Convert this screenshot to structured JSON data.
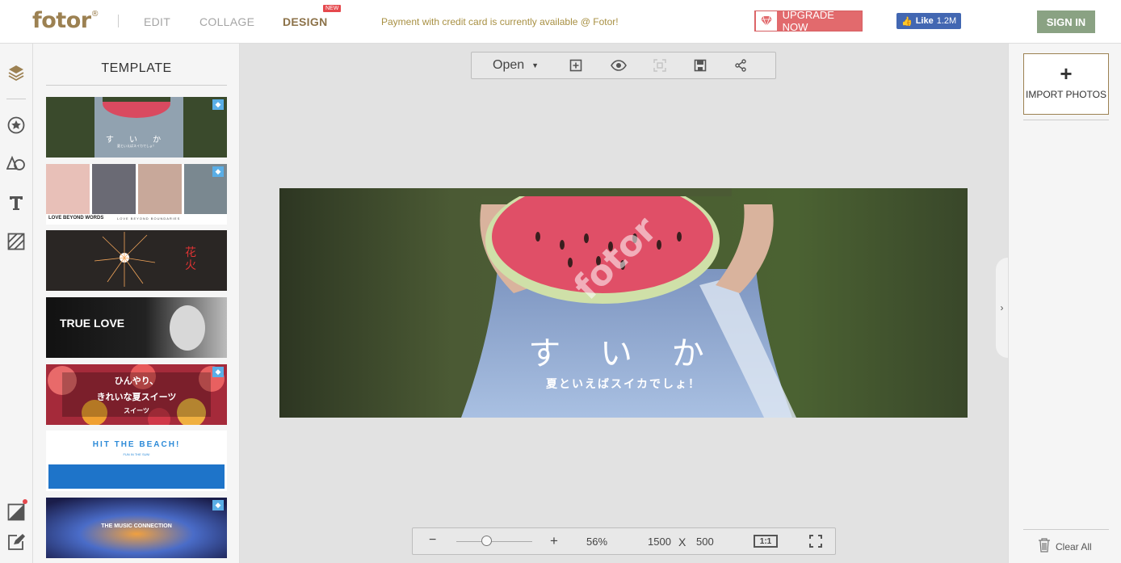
{
  "header": {
    "logo": "fotor",
    "logo_mark": "®",
    "nav": [
      "EDIT",
      "COLLAGE",
      "DESIGN"
    ],
    "new_badge": "NEW",
    "promo": "Payment with credit card is currently available @ Fotor!",
    "upgrade_label": "UPGRADE NOW",
    "fb_like": "Like",
    "fb_count": "1.2M",
    "signin": "SIGN IN"
  },
  "sidebar": {
    "icons": [
      "layers-icon",
      "sticker-icon",
      "shapes-icon",
      "text-icon",
      "pattern-icon",
      "background-icon",
      "edit-icon"
    ]
  },
  "templates": {
    "title": "TEMPLATE",
    "items": [
      {
        "text": "す い か",
        "subtext": "夏といえばスイカでしょ！"
      },
      {
        "text": "LOVE BEYOND WORDS",
        "subtext": "LOVE BEYOND BOUNDARIES"
      },
      {
        "text": "花火",
        "subtext": ""
      },
      {
        "text": "TRUE LOVE",
        "subtext": ""
      },
      {
        "text": "ひんやり、",
        "subtext": "きれいな夏スイーツ",
        "subtext2": "スイーツ"
      },
      {
        "text": "HIT THE BEACH!",
        "subtext": "FUN IN THE SUN!"
      },
      {
        "text": "THE MUSIC CONNECTION",
        "subtext": ""
      }
    ]
  },
  "toolbar": {
    "open_label": "Open"
  },
  "canvas": {
    "title": "す い か",
    "subtitle": "夏といえばスイカでしょ！",
    "watermark": "fotor"
  },
  "zoom": {
    "minus": "−",
    "plus": "+",
    "percent": "56%",
    "width": "1500",
    "x": "X",
    "height": "500",
    "ratio": "1:1",
    "level": 0.4
  },
  "right": {
    "import_plus": "+",
    "import_label": "IMPORT PHOTOS",
    "clear_label": "Clear All"
  }
}
